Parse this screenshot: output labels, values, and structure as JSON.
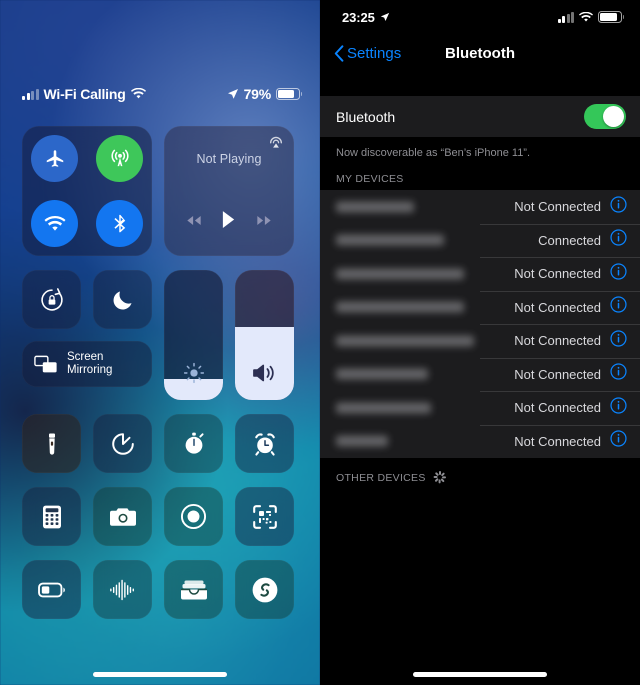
{
  "control_center": {
    "status_bar": {
      "carrier_text": "Wi-Fi Calling",
      "signal_icon": "cellular-bars-icon",
      "wifi_icon": "wifi-icon",
      "location_icon": "location-arrow-icon",
      "battery_percent": "79%",
      "battery_level": 79
    },
    "connectivity": {
      "airplane": {
        "name": "airplane-mode-toggle",
        "state": "off"
      },
      "cellular": {
        "name": "cellular-data-toggle",
        "state": "on"
      },
      "wifi": {
        "name": "wifi-toggle",
        "state": "on"
      },
      "bluetooth": {
        "name": "bluetooth-toggle",
        "state": "on"
      }
    },
    "now_playing": {
      "title": "Not Playing",
      "airplay_icon": "airplay-audio-icon",
      "previous_icon": "rewind-icon",
      "play_icon": "play-icon",
      "next_icon": "fast-forward-icon"
    },
    "rotation_lock": {
      "label": "rotation-lock",
      "icon": "rotation-lock-icon"
    },
    "do_not_disturb": {
      "label": "do-not-disturb",
      "icon": "moon-icon"
    },
    "screen_mirroring": {
      "line1": "Screen",
      "line2": "Mirroring",
      "icon": "screen-mirroring-icon"
    },
    "brightness_slider": {
      "icon": "brightness-icon",
      "value": 16
    },
    "volume_slider": {
      "icon": "speaker-wave-icon",
      "value": 56
    },
    "tiles": [
      {
        "name": "flashlight",
        "icon": "flashlight-icon"
      },
      {
        "name": "timer",
        "icon": "timer-icon"
      },
      {
        "name": "stopwatch",
        "icon": "stopwatch-icon"
      },
      {
        "name": "alarm",
        "icon": "alarm-clock-icon"
      },
      {
        "name": "calculator",
        "icon": "calculator-icon"
      },
      {
        "name": "camera",
        "icon": "camera-icon"
      },
      {
        "name": "screen-recording",
        "icon": "record-icon"
      },
      {
        "name": "qr-code-scanner",
        "icon": "qr-code-icon"
      },
      {
        "name": "low-power-mode",
        "icon": "battery-icon"
      },
      {
        "name": "voice-memos",
        "icon": "waveform-icon"
      },
      {
        "name": "wallet",
        "icon": "wallet-icon"
      },
      {
        "name": "shazam",
        "icon": "shazam-icon"
      }
    ]
  },
  "bluetooth_settings": {
    "status_bar": {
      "time": "23:25",
      "location_icon": "location-arrow-icon",
      "signal_icon": "cellular-bars-icon",
      "wifi_icon": "wifi-icon",
      "battery_icon": "battery-icon"
    },
    "nav": {
      "back_label": "Settings",
      "back_icon": "chevron-left-icon",
      "title": "Bluetooth"
    },
    "toggle": {
      "label": "Bluetooth",
      "state": "on"
    },
    "discoverable_text": "Now discoverable as “Ben’s iPhone 11”.",
    "my_devices_header": "MY DEVICES",
    "other_devices_header": "OTHER DEVICES",
    "spinner_icon": "activity-spinner-icon",
    "info_icon": "info-circle-icon",
    "devices": [
      {
        "name_blurred": true,
        "name_width": 78,
        "status": "Not Connected"
      },
      {
        "name_blurred": true,
        "name_width": 108,
        "status": "Connected"
      },
      {
        "name_blurred": true,
        "name_width": 128,
        "status": "Not Connected"
      },
      {
        "name_blurred": true,
        "name_width": 128,
        "status": "Not Connected"
      },
      {
        "name_blurred": true,
        "name_width": 138,
        "status": "Not Connected"
      },
      {
        "name_blurred": true,
        "name_width": 92,
        "status": "Not Connected"
      },
      {
        "name_blurred": true,
        "name_width": 95,
        "status": "Not Connected"
      },
      {
        "name_blurred": true,
        "name_width": 52,
        "status": "Not Connected"
      }
    ]
  },
  "colors": {
    "ios_blue": "#0a84ff",
    "switch_green": "#34c759",
    "cellular_green": "#3ec75a",
    "toggle_blue": "#1376f0",
    "list_bg": "#1c1c1e",
    "secondary_text": "#8e8e93"
  }
}
